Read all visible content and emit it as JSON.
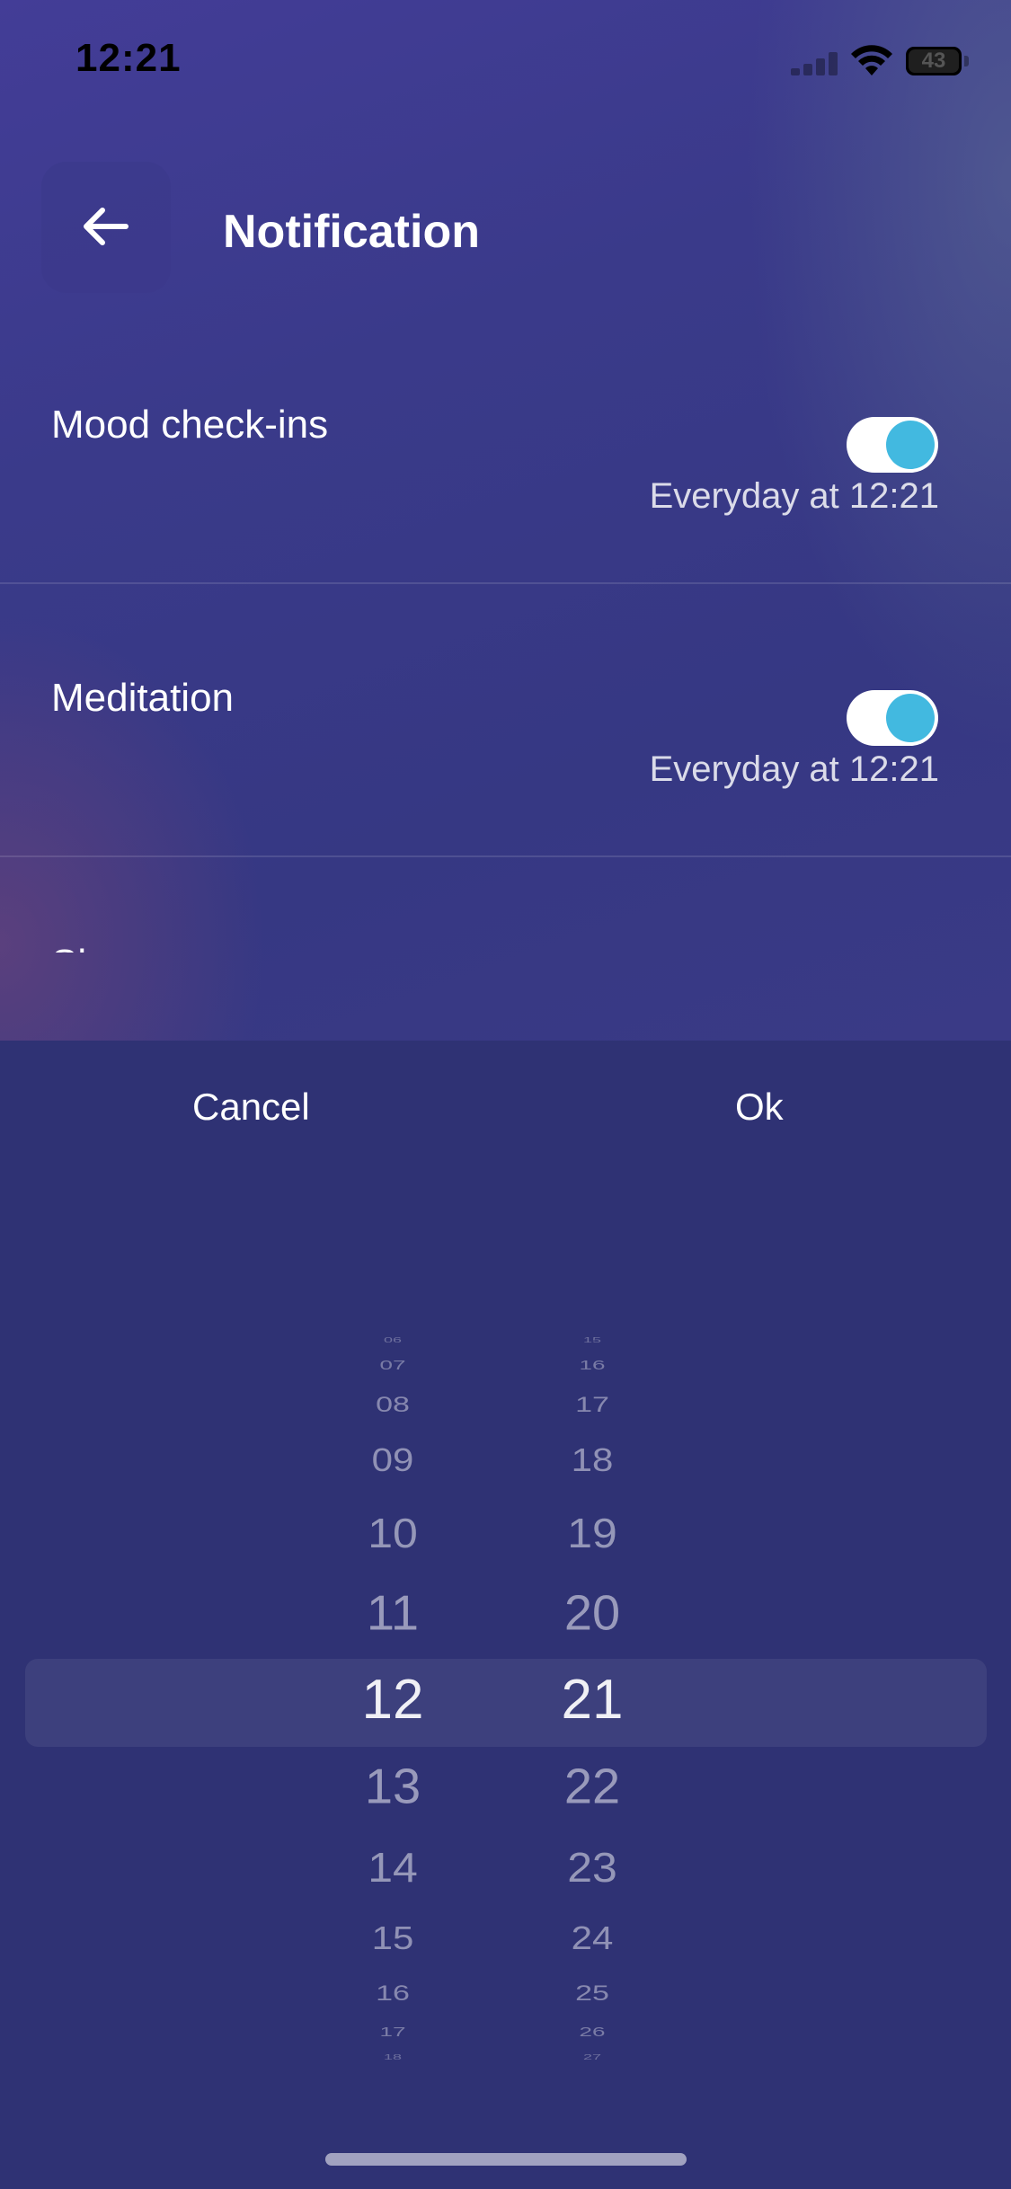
{
  "status_bar": {
    "time": "12:21",
    "battery": "43"
  },
  "header": {
    "title": "Notification"
  },
  "rows": [
    {
      "label": "Mood check-ins",
      "schedule": "Everyday at 12:21",
      "enabled": true
    },
    {
      "label": "Meditation",
      "schedule": "Everyday at 12:21",
      "enabled": true
    },
    {
      "label": "Sleep",
      "enabled": true
    }
  ],
  "picker": {
    "cancel_label": "Cancel",
    "ok_label": "Ok",
    "hours": [
      "06",
      "07",
      "08",
      "09",
      "10",
      "11",
      "12",
      "13",
      "14",
      "15",
      "16",
      "17",
      "18"
    ],
    "minutes": [
      "15",
      "16",
      "17",
      "18",
      "19",
      "20",
      "21",
      "22",
      "23",
      "24",
      "25",
      "26",
      "27"
    ],
    "selected_hour": "12",
    "selected_minute": "21"
  },
  "colors": {
    "accent": "#42b9e0",
    "background": "#2f3274"
  }
}
